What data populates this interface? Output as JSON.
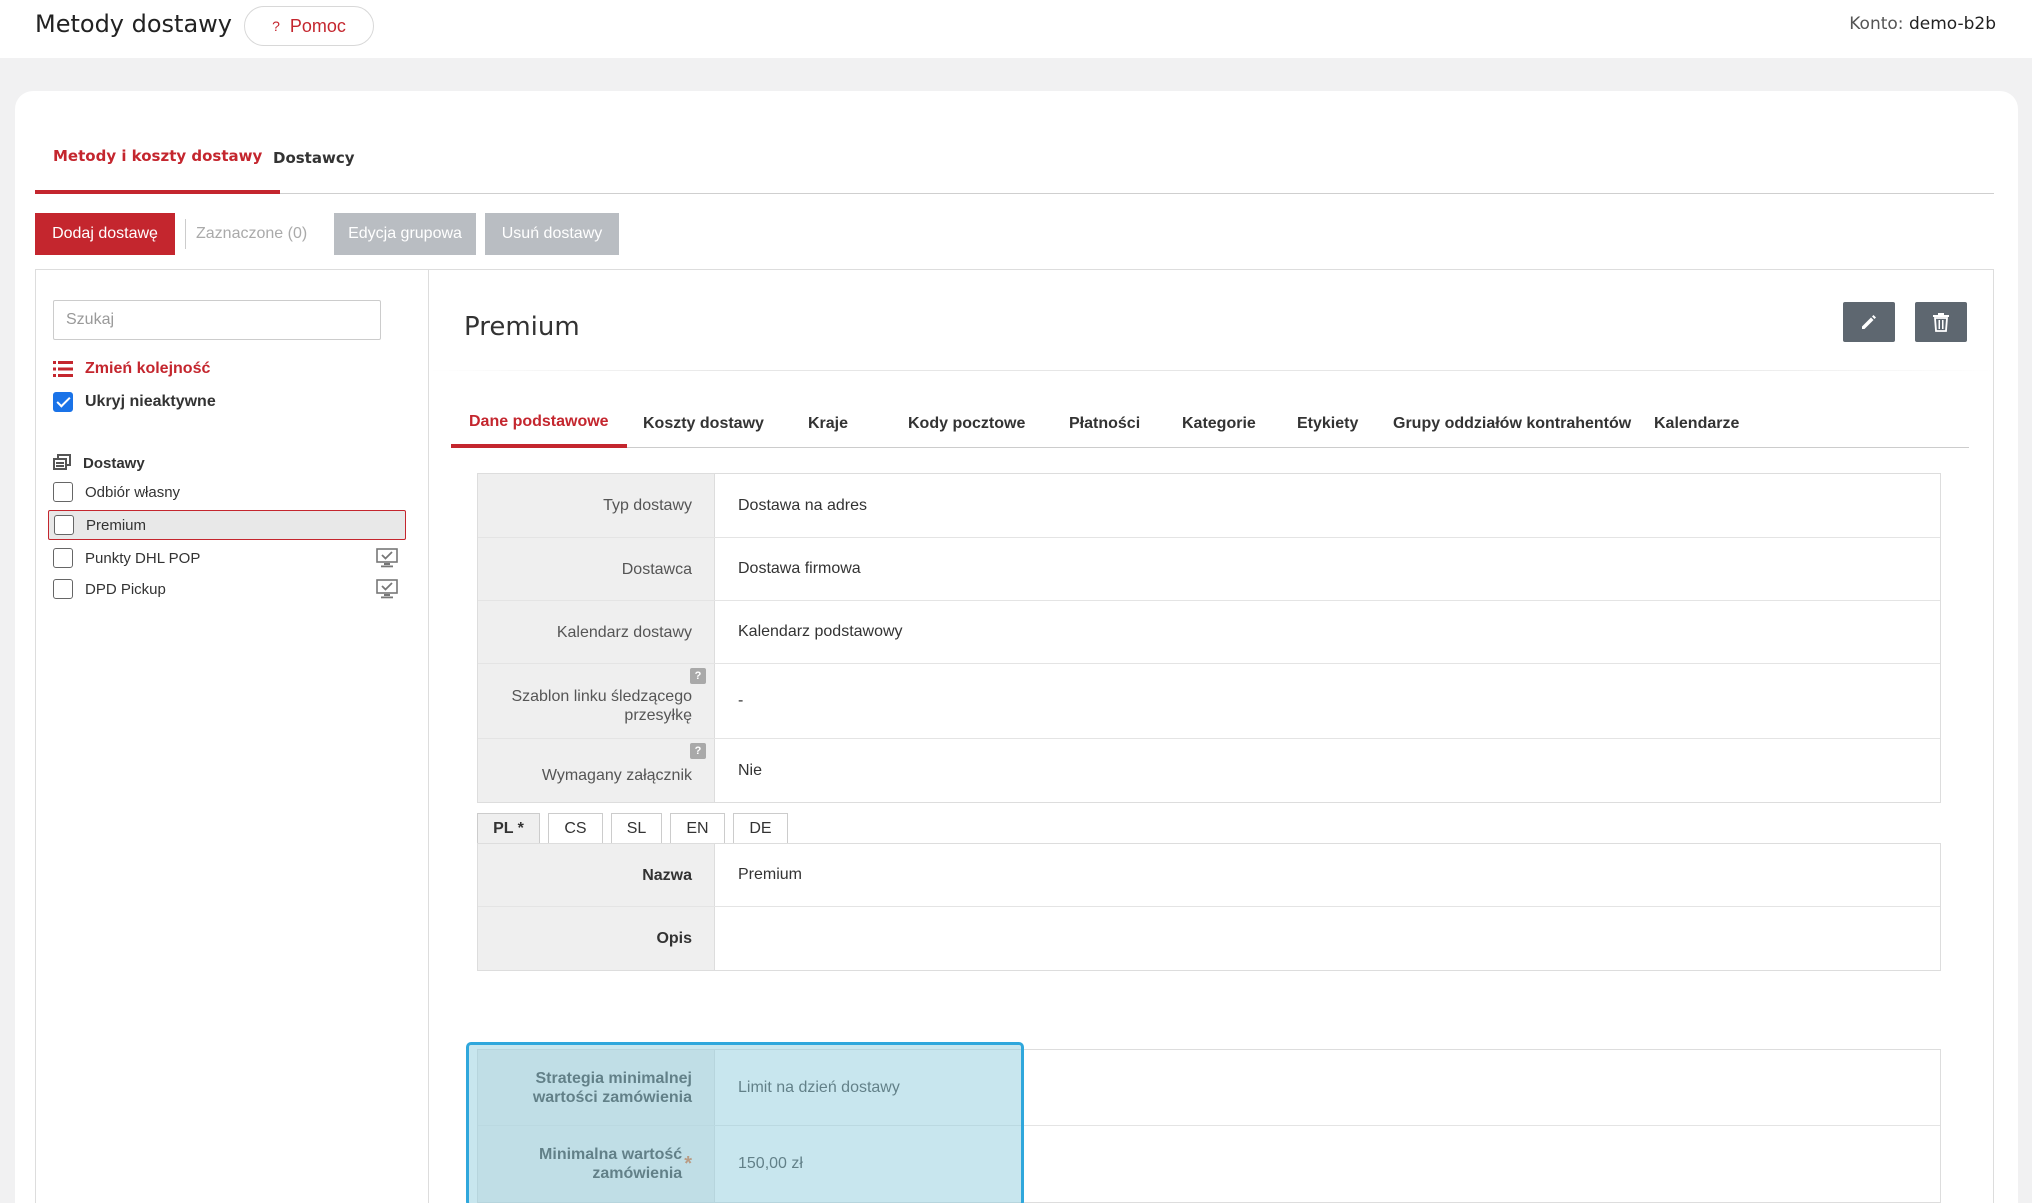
{
  "header": {
    "title": "Metody dostawy",
    "help_label": "Pomoc",
    "help_icon": "?",
    "account_label": "Konto:",
    "account_value": "demo-b2b"
  },
  "main_tabs": [
    {
      "label": "Metody i koszty dostawy",
      "active": true
    },
    {
      "label": "Dostawcy",
      "active": false
    }
  ],
  "toolbar": {
    "add_label": "Dodaj dostawę",
    "selected_label": "Zaznaczone (0)",
    "bulk_edit_label": "Edycja grupowa",
    "delete_label": "Usuń dostawy"
  },
  "sidebar": {
    "search_placeholder": "Szukaj",
    "reorder_label": "Zmień kolejność",
    "hide_inactive_label": "Ukryj nieaktywne",
    "hide_inactive_checked": true,
    "group_label": "Dostawy",
    "items": [
      {
        "label": "Odbiór własny",
        "selected": false,
        "badge": false
      },
      {
        "label": "Premium",
        "selected": true,
        "badge": false
      },
      {
        "label": "Punkty DHL POP",
        "selected": false,
        "badge": true
      },
      {
        "label": "DPD Pickup",
        "selected": false,
        "badge": true
      }
    ]
  },
  "detail": {
    "title": "Premium",
    "tabs": [
      {
        "label": "Dane podstawowe",
        "active": true
      },
      {
        "label": "Koszty dostawy"
      },
      {
        "label": "Kraje"
      },
      {
        "label": "Kody pocztowe"
      },
      {
        "label": "Płatności"
      },
      {
        "label": "Kategorie"
      },
      {
        "label": "Etykiety"
      },
      {
        "label": "Grupy oddziałów kontrahentów"
      },
      {
        "label": "Kalendarze"
      }
    ],
    "basic_fields": [
      {
        "label": "Typ dostawy",
        "value": "Dostawa na adres"
      },
      {
        "label": "Dostawca",
        "value": "Dostawa firmowa"
      },
      {
        "label": "Kalendarz dostawy",
        "value": "Kalendarz podstawowy"
      },
      {
        "label": "Szablon linku śledzącego przesyłkę",
        "value": "-",
        "help": "?"
      },
      {
        "label": "Wymagany załącznik",
        "value": "Nie",
        "help": "?"
      }
    ],
    "languages": [
      "PL *",
      "CS",
      "SL",
      "EN",
      "DE"
    ],
    "lang_fields": [
      {
        "label": "Nazwa",
        "value": "Premium"
      },
      {
        "label": "Opis",
        "value": ""
      }
    ],
    "order_fields": [
      {
        "label": "Strategia minimalnej wartości zamówienia",
        "value": "Limit na dzień dostawy"
      },
      {
        "label": "Minimalna wartość zamówienia",
        "value": "150,00 zł",
        "required": "*"
      }
    ]
  },
  "colors": {
    "accent": "#c4262e",
    "highlight": "#2fa7dc"
  }
}
